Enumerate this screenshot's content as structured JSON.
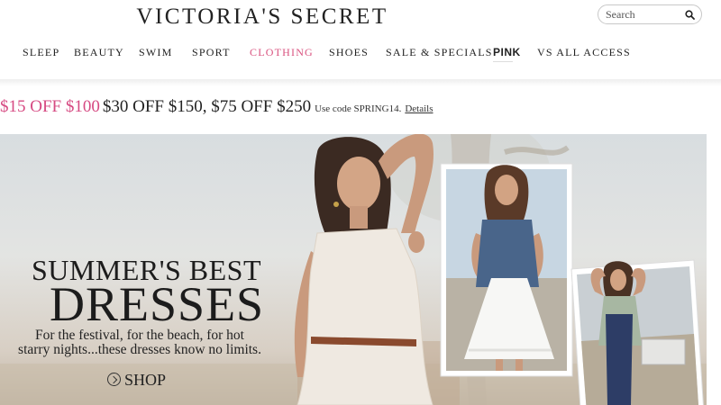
{
  "header": {
    "brand": "VICTORIA'S SECRET",
    "search_placeholder": "Search"
  },
  "nav": {
    "items": [
      "SLEEP",
      "BEAUTY",
      "SWIM",
      "SPORT",
      "CLOTHING",
      "SHOES",
      "SALE & SPECIALS",
      "PINK",
      "VS ALL ACCESS"
    ],
    "active": "CLOTHING"
  },
  "promo": {
    "highlight": "$15 OFF $100",
    "offers": "$30 OFF $150, $75 OFF $250",
    "code_text": "Use code SPRING14.",
    "details_link": "Details"
  },
  "hero": {
    "title_line1": "SUMMER'S BEST",
    "title_line2": "DRESSES",
    "description": "For the festival, for the beach, for hot starry nights...these dresses know no limits.",
    "cta": "SHOP"
  },
  "colors": {
    "accent_pink": "#d64a82",
    "text_dark": "#222222"
  },
  "icons": {
    "search": "magnifier-icon",
    "cta": "circle-chevron-right-icon"
  }
}
